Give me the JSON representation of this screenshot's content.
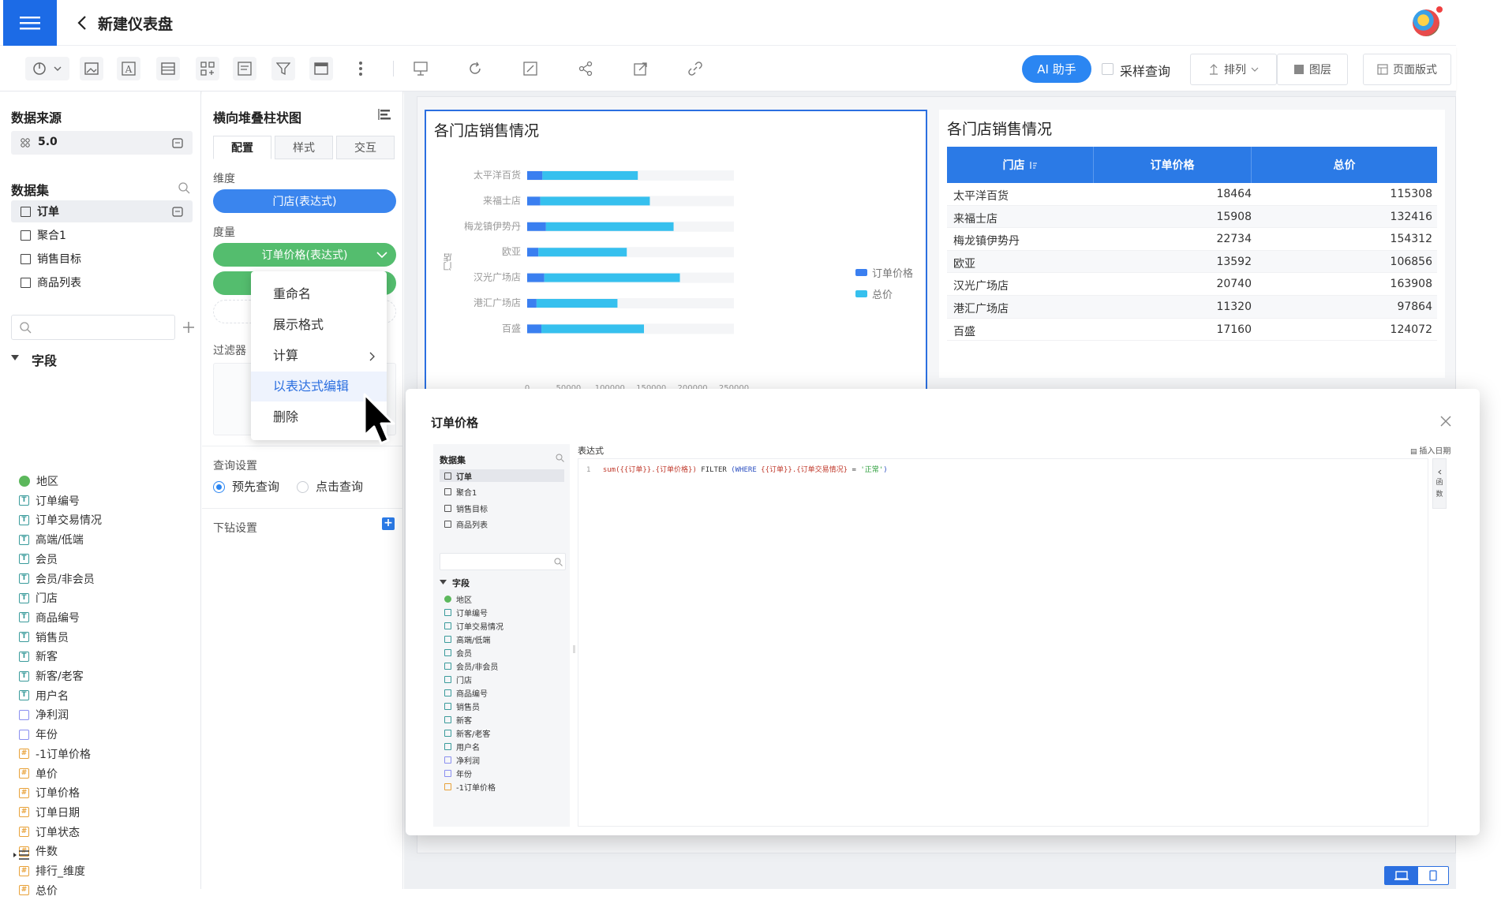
{
  "header": {
    "title": "新建仪表盘"
  },
  "toolbar": {
    "ai_label": "AI 助手",
    "sample_label": "采样查询",
    "sort_label": "排列",
    "layer_label": "图层",
    "page_label": "页面版式"
  },
  "left": {
    "datasource_title": "数据来源",
    "datasource_value": "5.0",
    "dataset_title": "数据集",
    "datasets": [
      "订单",
      "聚合1",
      "销售目标",
      "商品列表"
    ],
    "fields_title": "字段",
    "fields": [
      {
        "name": "地区",
        "type": "geo"
      },
      {
        "name": "订单编号",
        "type": "text"
      },
      {
        "name": "订单交易情况",
        "type": "text"
      },
      {
        "name": "高端/低端",
        "type": "text"
      },
      {
        "name": "会员",
        "type": "text"
      },
      {
        "name": "会员/非会员",
        "type": "text"
      },
      {
        "name": "门店",
        "type": "text"
      },
      {
        "name": "商品编号",
        "type": "text"
      },
      {
        "name": "销售员",
        "type": "text"
      },
      {
        "name": "新客",
        "type": "text"
      },
      {
        "name": "新客/老客",
        "type": "text"
      },
      {
        "name": "用户名",
        "type": "text"
      },
      {
        "name": "净利润",
        "type": "date"
      },
      {
        "name": "年份",
        "type": "date"
      },
      {
        "name": "-1订单价格",
        "type": "num"
      },
      {
        "name": "单价",
        "type": "num"
      },
      {
        "name": "订单价格",
        "type": "num"
      },
      {
        "name": "订单日期",
        "type": "num"
      },
      {
        "name": "订单状态",
        "type": "num"
      },
      {
        "name": "件数",
        "type": "num"
      },
      {
        "name": "排行_维度",
        "type": "num"
      },
      {
        "name": "总价",
        "type": "num"
      }
    ]
  },
  "config": {
    "chart_type": "横向堆叠柱状图",
    "tabs": [
      "配置",
      "样式",
      "交互"
    ],
    "dimension_label": "维度",
    "dimension_pill": "门店(表达式)",
    "measure_label": "度量",
    "measure_pill": "订单价格(表达式)",
    "filter_label": "过滤器",
    "query_label": "查询设置",
    "query_opt1": "预先查询",
    "query_opt2": "点击查询",
    "drill_label": "下钻设置"
  },
  "context_menu": [
    "重命名",
    "展示格式",
    "计算",
    "以表达式编辑",
    "删除"
  ],
  "chart_card": {
    "title": "各门店销售情况",
    "axis_label": "门店",
    "legend": [
      "订单价格",
      "总价"
    ]
  },
  "chart_data": {
    "type": "bar",
    "orientation": "horizontal-stacked",
    "categories": [
      "太平洋百货",
      "来福士店",
      "梅龙镇伊势丹",
      "欧亚",
      "汉光广场店",
      "港汇广场店",
      "百盛"
    ],
    "series": [
      {
        "name": "订单价格",
        "values": [
          18464,
          15908,
          22734,
          13592,
          20740,
          11320,
          17160
        ],
        "color": "#3a7ff0"
      },
      {
        "name": "总价",
        "values": [
          115308,
          132416,
          154312,
          106856,
          163908,
          97864,
          124072
        ],
        "color": "#36c0ee"
      }
    ],
    "xlim": [
      0,
      250000
    ],
    "xticks": [
      "0",
      "50000",
      "100000",
      "150000",
      "200000",
      "250000"
    ]
  },
  "table_card": {
    "title": "各门店销售情况",
    "headers": [
      "门店",
      "订单价格",
      "总价"
    ],
    "rows": [
      [
        "太平洋百货",
        "18464",
        "115308"
      ],
      [
        "来福士店",
        "15908",
        "132416"
      ],
      [
        "梅龙镇伊势丹",
        "22734",
        "154312"
      ],
      [
        "欧亚",
        "13592",
        "106856"
      ],
      [
        "汉光广场店",
        "20740",
        "163908"
      ],
      [
        "港汇广场店",
        "11320",
        "97864"
      ],
      [
        "百盛",
        "17160",
        "124072"
      ]
    ]
  },
  "dialog": {
    "title": "订单价格",
    "dataset_title": "数据集",
    "datasets": [
      "订单",
      "聚合1",
      "销售目标",
      "商品列表"
    ],
    "fields_title": "字段",
    "fields": [
      "地区",
      "订单编号",
      "订单交易情况",
      "高端/低端",
      "会员",
      "会员/非会员",
      "门店",
      "商品编号",
      "销售员",
      "新客",
      "新客/老客",
      "用户名",
      "净利润",
      "年份",
      "-1订单价格"
    ],
    "expr_label": "表达式",
    "insert_date": "插入日期",
    "line_no": "1",
    "code": {
      "p1": "sum({{订单}}.{订单价格})",
      "p2": " FILTER ",
      "p3": "(WHERE ",
      "p4": "{{订单}}.{订单交易情况}",
      "p5": " = ",
      "p6": "'正常'",
      "p7": ")"
    },
    "fn_tab": [
      "函",
      "数"
    ]
  }
}
